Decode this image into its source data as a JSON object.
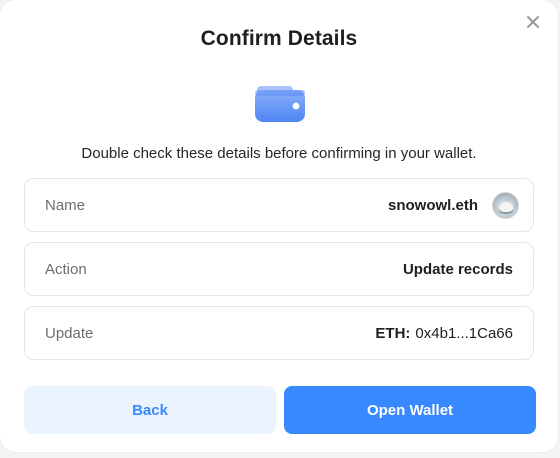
{
  "dialog": {
    "title": "Confirm Details",
    "subtitle": "Double check these details before confirming in your wallet.",
    "close_icon": "close-icon",
    "wallet_icon": "wallet-icon"
  },
  "details": [
    {
      "label": "Name",
      "value": "snowowl.eth",
      "avatar": "ens-avatar"
    },
    {
      "label": "Action",
      "value": "Update records"
    },
    {
      "label": "Update",
      "value_prefix": "ETH:",
      "value": "0x4b1...1Ca66"
    }
  ],
  "buttons": {
    "back": "Back",
    "open_wallet": "Open Wallet"
  },
  "colors": {
    "accent": "#3889FF",
    "accent_light": "#EAF3FE",
    "wallet_gradient_top": "#7CA5F8",
    "wallet_gradient_bottom": "#5B8DF5"
  }
}
